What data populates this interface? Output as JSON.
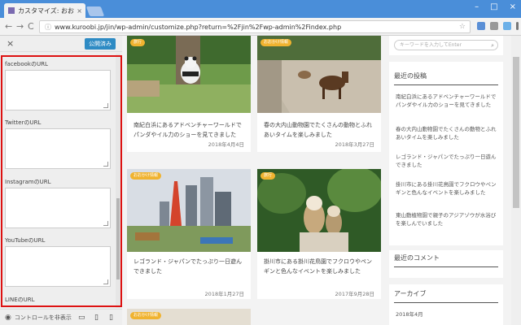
{
  "browser": {
    "tab_title": "カスタマイズ: おおかけ日記",
    "tab_close": "×",
    "url": "www.kuroobi.jp/jin/wp-admin/customize.php?return=%2Fjin%2Fwp-admin%2Findex.php",
    "window_controls": [
      "–",
      "□",
      "×"
    ],
    "nav_icons": [
      "←",
      "→",
      "C"
    ],
    "bookmark_icon": "☆"
  },
  "customizer": {
    "close_label": "×",
    "publish_label": "公開済み",
    "fields": [
      {
        "label": "facebookのURL"
      },
      {
        "label": "TwitterのURL"
      },
      {
        "label": "InstagramのURL"
      },
      {
        "label": "YouTubeのURL"
      },
      {
        "label": "LINEのURL"
      }
    ],
    "footer_hide": "コントロールを非表示",
    "highlight_color": "#dd1111"
  },
  "preview": {
    "cards": [
      {
        "badge": "旅行",
        "title": "南紀白浜にあるアドベンチャーワールドでパンダやイル力のショーを見てきました",
        "date": "2018年4月4日"
      },
      {
        "badge": "おおかけ情報",
        "title": "春の大内山動物園でたくさんの動物とふれあいタイムを楽しみました",
        "date": "2018年3月27日"
      },
      {
        "badge": "おおかけ情報",
        "title": "レゴランド・ジャパンでたっぷり一日遊んできました",
        "date": "2018年1月27日"
      },
      {
        "badge": "旅行",
        "title": "掛川市にある掛川花鳥園でフクロウやペンギンと色んなイベントを楽しみました",
        "date": "2017年9月28日"
      },
      {
        "badge": "おおかけ情報"
      }
    ],
    "search_placeholder": "キーワードを入力してEnter",
    "recent_posts_title": "最近の投稿",
    "recent_posts": [
      "南紀白浜にあるアドベンチャーワールドでパンダやイル力のショーを見てきました",
      "春の大内山動物園でたくさんの動物とふれあいタイムを楽しみました",
      "レゴランド・ジャパンでたっぷり一日遊んできました",
      "掛川市にある掛川花鳥園でフクロウやペンギンと色んなイベントを楽しみました",
      "東山動植物園で親子のアジアゾウが水浴びを楽しんでいました"
    ],
    "recent_comments_title": "最近のコメント",
    "archives_title": "アーカイブ",
    "archives": [
      "2018年4月"
    ],
    "badge_color": "#f0b330"
  }
}
